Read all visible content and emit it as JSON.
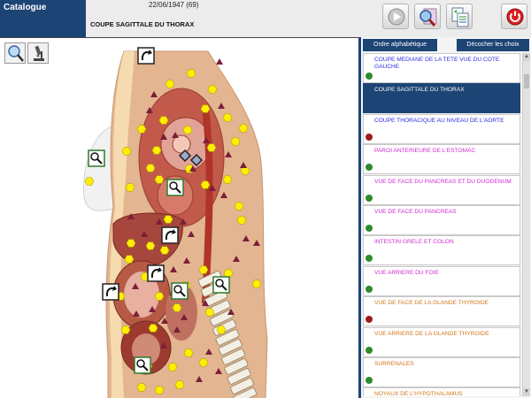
{
  "app": {
    "catalogue_label": "Catalogue"
  },
  "header": {
    "date_line": "22/06/1947 (69)",
    "view_title": "COUPE SAGITTALE DU THORAX",
    "buttons": [
      "play-icon",
      "search-magnify-icon",
      "copy-documents-icon",
      "power-icon"
    ]
  },
  "tools": [
    "magnifier-icon",
    "microscope-icon"
  ],
  "list_header": {
    "sort_label": "Ordre alphabétique",
    "uncheck_label": "Décocher les choix"
  },
  "list": [
    {
      "label": "COUPE MEDIANE DE LA TETE VUE DU COTE GAUCHE",
      "color": "#2a2ae6",
      "dot": "#2e8b2e",
      "selected": false
    },
    {
      "label": "COUPE SAGITTALE DU THORAX",
      "color": "#ffffff",
      "dot": "",
      "selected": true
    },
    {
      "label": "COUPE THORACIQUE AU NIVEAU DE L'AORTE",
      "color": "#2a2ae6",
      "dot": "#9b1c1c",
      "selected": false
    },
    {
      "label": "PAROI ANTERIEURE DE L'ESTOMAC",
      "color": "#d22ad2",
      "dot": "#2e8b2e",
      "selected": false
    },
    {
      "label": "VUE DE FACE DU PANCREAS ET DU DUODENUM",
      "color": "#d22ad2",
      "dot": "#2e8b2e",
      "selected": false
    },
    {
      "label": "VUE DE FACE DU PANCREAS",
      "color": "#d22ad2",
      "dot": "#2e8b2e",
      "selected": false
    },
    {
      "label": "INTESTIN GRELE ET COLON",
      "color": "#d22ad2",
      "dot": "#2e8b2e",
      "selected": false
    },
    {
      "label": "VUE ARRIERE DU FOIE",
      "color": "#d22ad2",
      "dot": "#2e8b2e",
      "selected": false
    },
    {
      "label": "VUE DE FACE DE LA GLANDE THYROIDE",
      "color": "#d2761a",
      "dot": "#9b1c1c",
      "selected": false
    },
    {
      "label": "VUE ARRIERE DE LA GLANDE THYROIDE",
      "color": "#d2761a",
      "dot": "#2e8b2e",
      "selected": false
    },
    {
      "label": "SURRENALES",
      "color": "#d2761a",
      "dot": "#2e8b2e",
      "selected": false
    },
    {
      "label": "NOYAUX DE L'HYPOTHALAMUS",
      "color": "#d2761a",
      "dot": "",
      "selected": false
    }
  ],
  "colors": {
    "accent": "#1c4474",
    "marker_yellow": "#ffee00",
    "marker_triangle": "#7a1f3a"
  }
}
